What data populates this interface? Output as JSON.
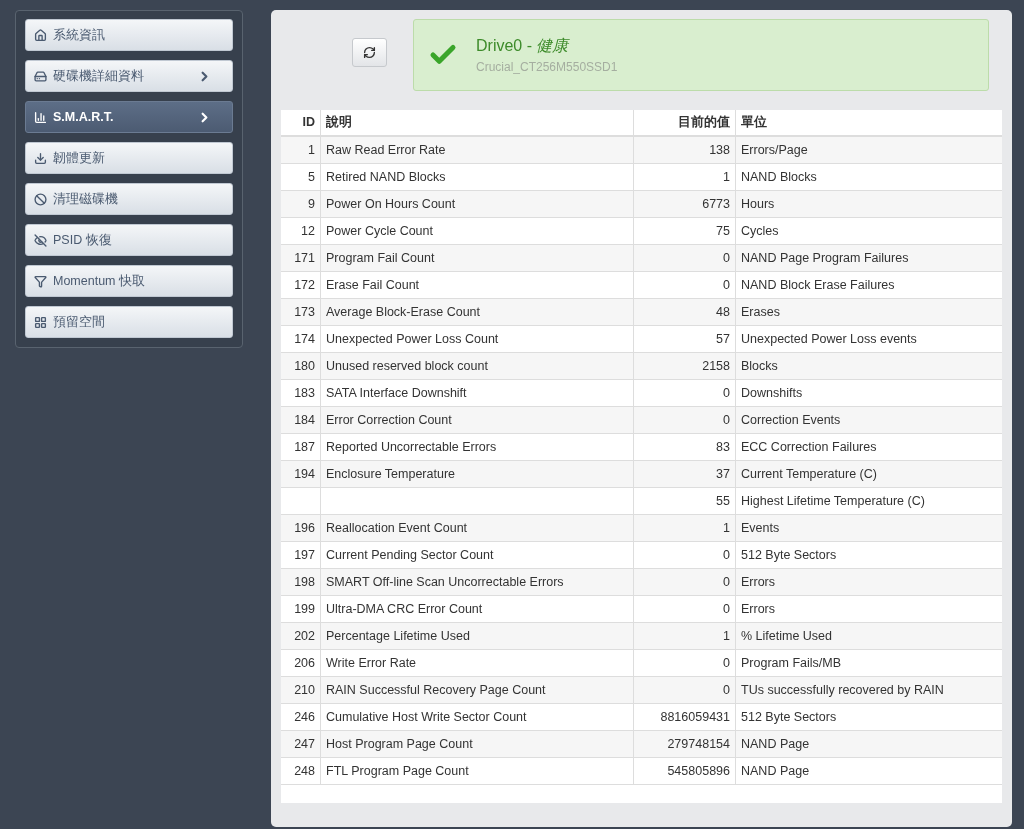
{
  "sidebar": {
    "items": [
      {
        "label": "系統資訊",
        "selected": false,
        "has_submenu": false
      },
      {
        "label": "硬碟機詳細資料",
        "selected": false,
        "has_submenu": true
      },
      {
        "label": "S.M.A.R.T.",
        "selected": true,
        "has_submenu": true
      },
      {
        "label": "韌體更新",
        "selected": false,
        "has_submenu": false
      },
      {
        "label": "清理磁碟機",
        "selected": false,
        "has_submenu": false
      },
      {
        "label": "PSID 恢復",
        "selected": false,
        "has_submenu": false
      },
      {
        "label": "Momentum 快取",
        "selected": false,
        "has_submenu": false
      },
      {
        "label": "預留空間",
        "selected": false,
        "has_submenu": false
      }
    ]
  },
  "drive_status": {
    "healthy": true,
    "title": "Drive0 - *健康*",
    "model": "Crucial_CT256M550SSD1"
  },
  "table": {
    "columns": [
      "ID",
      "說明",
      "目前的值",
      "單位"
    ],
    "rows": [
      {
        "id": "1",
        "description": "Raw Read Error Rate",
        "value": "138",
        "unit": "Errors/Page"
      },
      {
        "id": "5",
        "description": "Retired NAND Blocks",
        "value": "1",
        "unit": "NAND Blocks"
      },
      {
        "id": "9",
        "description": "Power On Hours Count",
        "value": "6773",
        "unit": "Hours"
      },
      {
        "id": "12",
        "description": "Power Cycle Count",
        "value": "75",
        "unit": "Cycles"
      },
      {
        "id": "171",
        "description": "Program Fail Count",
        "value": "0",
        "unit": "NAND Page Program Failures"
      },
      {
        "id": "172",
        "description": "Erase Fail Count",
        "value": "0",
        "unit": "NAND Block Erase Failures"
      },
      {
        "id": "173",
        "description": "Average Block-Erase Count",
        "value": "48",
        "unit": "Erases"
      },
      {
        "id": "174",
        "description": "Unexpected Power Loss Count",
        "value": "57",
        "unit": "Unexpected Power Loss events"
      },
      {
        "id": "180",
        "description": "Unused reserved block count",
        "value": "2158",
        "unit": "Blocks"
      },
      {
        "id": "183",
        "description": "SATA Interface Downshift",
        "value": "0",
        "unit": "Downshifts"
      },
      {
        "id": "184",
        "description": "Error Correction Count",
        "value": "0",
        "unit": "Correction Events"
      },
      {
        "id": "187",
        "description": "Reported Uncorrectable Errors",
        "value": "83",
        "unit": "ECC Correction Failures"
      },
      {
        "id": "194",
        "description": "Enclosure Temperature",
        "value": "37",
        "unit": "Current Temperature (C)"
      },
      {
        "value": "55",
        "unit": "Highest Lifetime Temperature (C)"
      },
      {
        "id": "196",
        "description": "Reallocation Event Count",
        "value": "1",
        "unit": "Events"
      },
      {
        "id": "197",
        "description": "Current Pending Sector Count",
        "value": "0",
        "unit": "512 Byte Sectors"
      },
      {
        "id": "198",
        "description": "SMART Off-line Scan Uncorrectable Errors",
        "value": "0",
        "unit": "Errors"
      },
      {
        "id": "199",
        "description": "Ultra-DMA CRC Error Count",
        "value": "0",
        "unit": "Errors"
      },
      {
        "id": "202",
        "description": "Percentage Lifetime Used",
        "value": "1",
        "unit": "% Lifetime Used"
      },
      {
        "id": "206",
        "description": "Write Error Rate",
        "value": "0",
        "unit": "Program Fails/MB"
      },
      {
        "id": "210",
        "description": "RAIN Successful Recovery Page Count",
        "value": "0",
        "unit": "TUs successfully recovered by RAIN"
      },
      {
        "id": "246",
        "description": "Cumulative Host Write Sector Count",
        "value": "8816059431",
        "unit": "512 Byte Sectors"
      },
      {
        "id": "247",
        "description": "Host Program Page Count",
        "value": "279748154",
        "unit": "NAND Page"
      },
      {
        "id": "248",
        "description": "FTL Program Page Count",
        "value": "545805896",
        "unit": "NAND Page"
      }
    ]
  }
}
